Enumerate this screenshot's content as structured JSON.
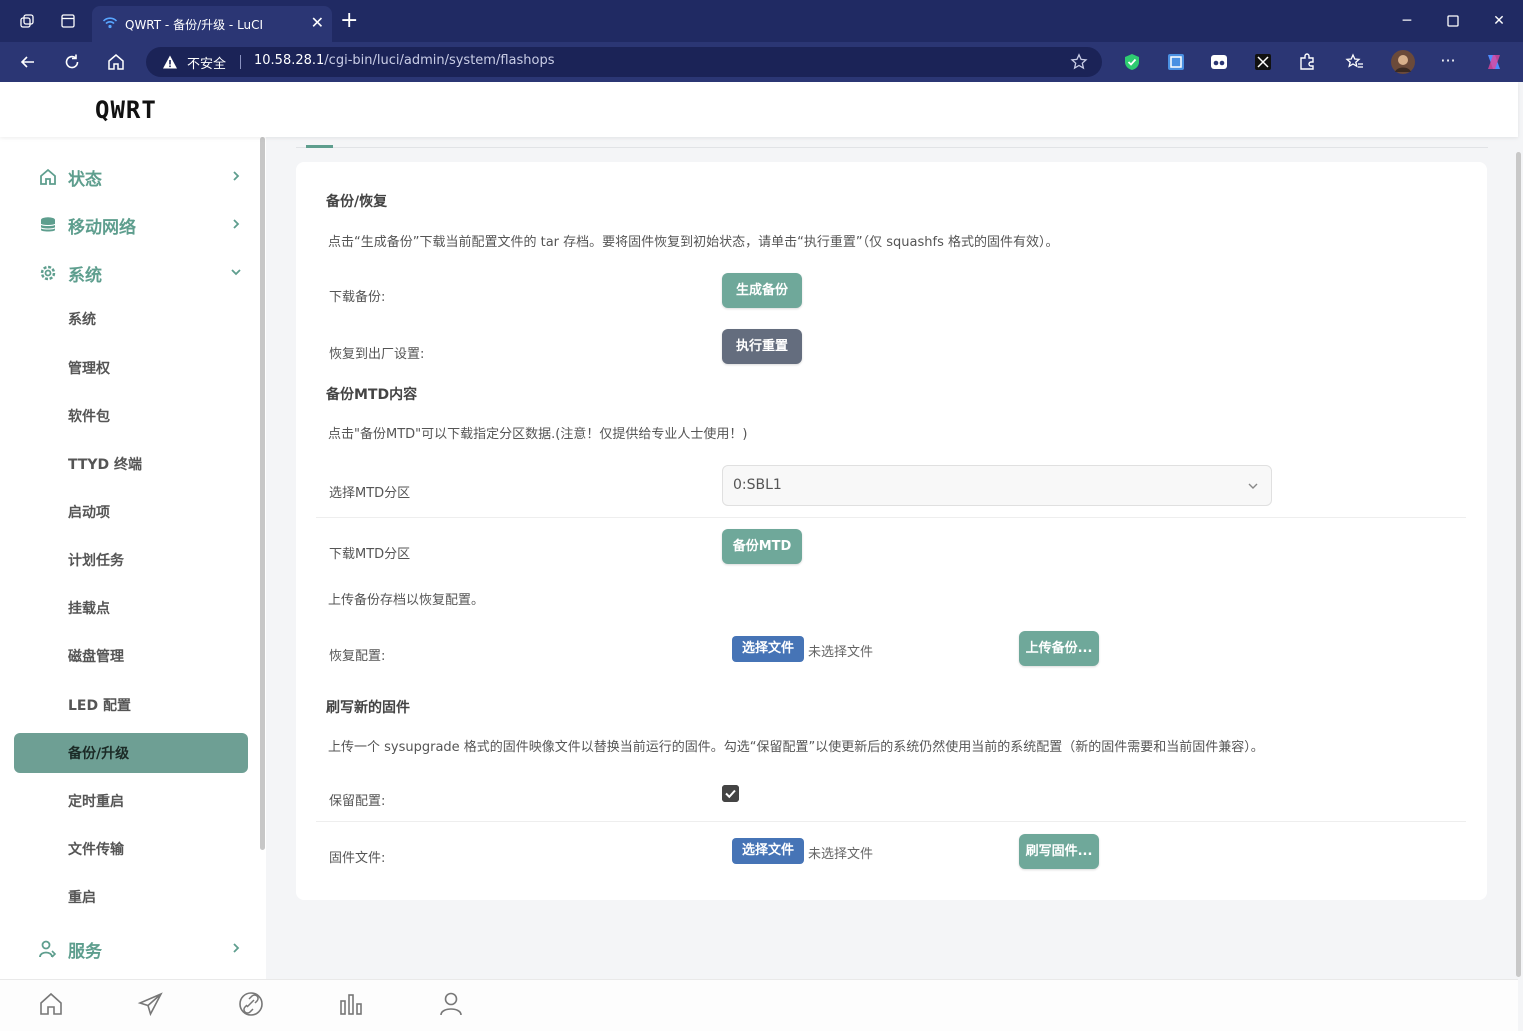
{
  "browser": {
    "tab_title": "QWRT - 备份/升级 - LuCI",
    "security_label": "不安全",
    "url_host": "10.58.28.1",
    "url_path": "/cgi-bin/luci/admin/system/flashops"
  },
  "brand": "QWRT",
  "sidebar": {
    "top_items": [
      {
        "label": "状态",
        "icon": "home-icon"
      },
      {
        "label": "移动网络",
        "icon": "database-icon"
      },
      {
        "label": "系统",
        "icon": "gear-icon"
      },
      {
        "label": "服务",
        "icon": "user-icon"
      }
    ],
    "sub_items": [
      "系统",
      "管理权",
      "软件包",
      "TTYD 终端",
      "启动项",
      "计划任务",
      "挂载点",
      "磁盘管理",
      "LED 配置",
      "备份/升级",
      "定时重启",
      "文件传输",
      "重启"
    ],
    "active_item": "备份/升级"
  },
  "backup": {
    "title": "备份/恢复",
    "description": "点击“生成备份”下载当前配置文件的 tar 存档。要将固件恢复到初始状态，请单击“执行重置”（仅 squashfs 格式的固件有效）。",
    "download_label": "下载备份:",
    "generate_button": "生成备份",
    "reset_label": "恢复到出厂设置:",
    "reset_button": "执行重置"
  },
  "mtd": {
    "title": "备份MTD内容",
    "description": "点击\"备份MTD\"可以下载指定分区数据.(注意！仅提供给专业人士使用！)",
    "select_label": "选择MTD分区",
    "select_value": "0:SBL1",
    "download_label": "下载MTD分区",
    "backup_button": "备份MTD"
  },
  "restore": {
    "description": "上传备份存档以恢复配置。",
    "label": "恢复配置:",
    "choose_file": "选择文件",
    "no_file": "未选择文件",
    "upload_button": "上传备份..."
  },
  "flash": {
    "title": "刷写新的固件",
    "description": "上传一个 sysupgrade 格式的固件映像文件以替换当前运行的固件。勾选“保留配置”以使更新后的系统仍然使用当前的系统配置（新的固件需要和当前固件兼容）。",
    "keep_label": "保留配置:",
    "keep_checked": true,
    "file_label": "固件文件:",
    "choose_file": "选择文件",
    "no_file": "未选择文件",
    "flash_button": "刷写固件..."
  },
  "colors": {
    "accent": "#5e9e8e",
    "button_green": "#6fa89a",
    "button_dark": "#646d7e",
    "file_button": "#4674b6",
    "titlebar": "#202a63"
  }
}
